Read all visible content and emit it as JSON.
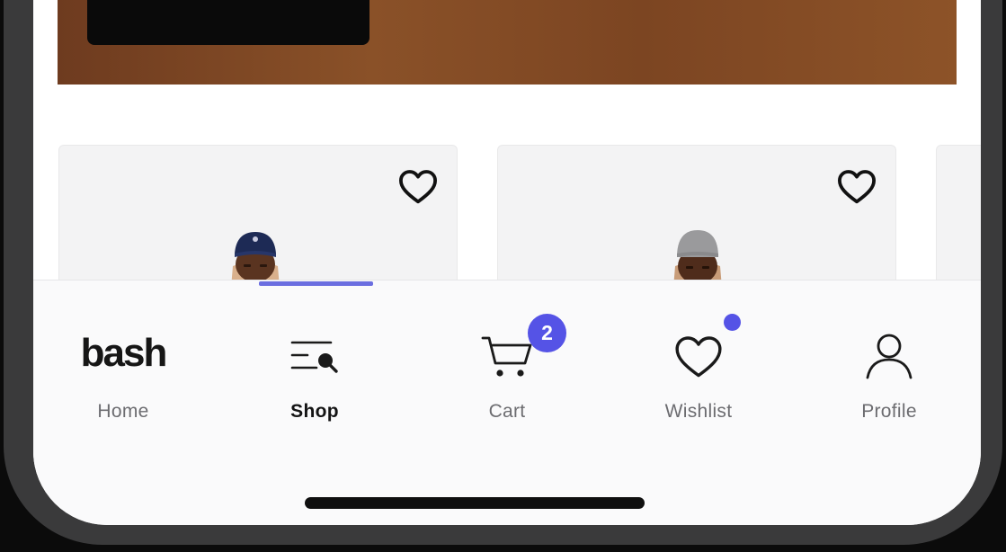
{
  "colors": {
    "accent": "#5553e6",
    "active_indicator": "#6b6ee0",
    "text_inactive": "#6c6c70",
    "text_active": "#141414"
  },
  "products": [
    {
      "favorite_icon": "heart-outline-icon"
    },
    {
      "favorite_icon": "heart-outline-icon"
    }
  ],
  "tabbar": {
    "active_tab": "Shop",
    "tabs": [
      {
        "id": "home",
        "label": "Home",
        "brand": "bash"
      },
      {
        "id": "shop",
        "label": "Shop",
        "icon": "list-search-icon"
      },
      {
        "id": "cart",
        "label": "Cart",
        "icon": "cart-icon",
        "badge": "2"
      },
      {
        "id": "wishlist",
        "label": "Wishlist",
        "icon": "heart-icon",
        "has_dot": true
      },
      {
        "id": "profile",
        "label": "Profile",
        "icon": "user-icon"
      }
    ]
  }
}
